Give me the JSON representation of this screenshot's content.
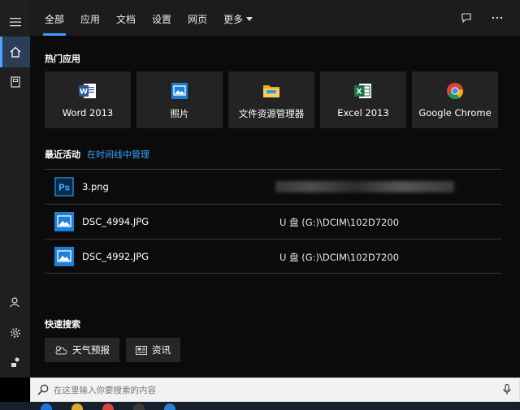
{
  "tabs": [
    {
      "label": "全部",
      "active": true
    },
    {
      "label": "应用"
    },
    {
      "label": "文档"
    },
    {
      "label": "设置"
    },
    {
      "label": "网页"
    },
    {
      "label": "更多"
    }
  ],
  "sections": {
    "top_apps": "热门应用",
    "recent": "最近活动",
    "recent_link": "在时间线中管理",
    "quick_search": "快速搜索"
  },
  "apps": [
    {
      "label": "Word 2013",
      "icon": "word-icon"
    },
    {
      "label": "照片",
      "icon": "photos-icon"
    },
    {
      "label": "文件资源管理器",
      "icon": "folder-icon"
    },
    {
      "label": "Excel 2013",
      "icon": "excel-icon"
    },
    {
      "label": "Google Chrome",
      "icon": "chrome-icon"
    }
  ],
  "recent": [
    {
      "name": "3.png",
      "path": "",
      "icon": "photoshop-icon"
    },
    {
      "name": "DSC_4994.JPG",
      "path": "U 盘 (G:)\\DCIM\\102D7200",
      "icon": "image-icon"
    },
    {
      "name": "DSC_4992.JPG",
      "path": "U 盘 (G:)\\DCIM\\102D7200",
      "icon": "image-icon"
    }
  ],
  "quick": [
    {
      "label": "天气预报",
      "icon": "weather-icon"
    },
    {
      "label": "资讯",
      "icon": "news-icon"
    }
  ],
  "search": {
    "placeholder": "在这里输入你要搜索的内容"
  },
  "colors": {
    "accent": "#3f9cff",
    "panel": "#0b0b0b",
    "tile": "#232323"
  }
}
